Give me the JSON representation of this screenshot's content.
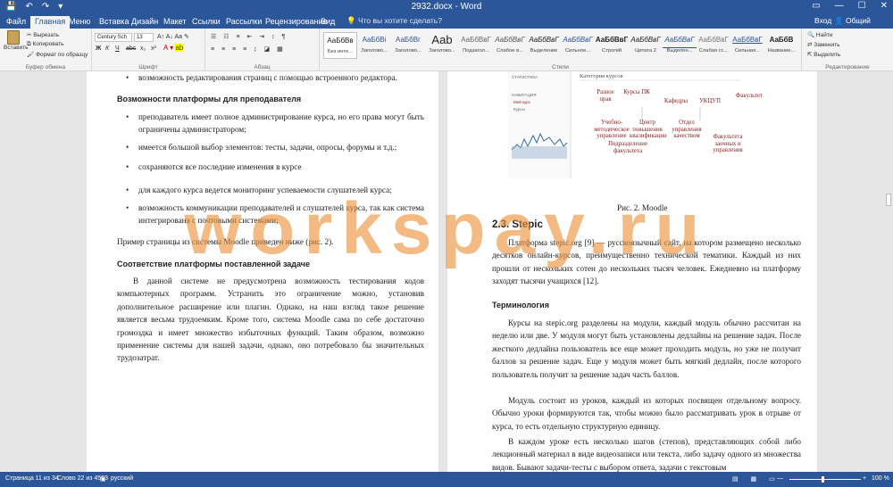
{
  "title_bar": {
    "doc_title": "2932.docx - Word",
    "quick_access": [
      "💾",
      "↶",
      "↷",
      "▾"
    ],
    "window_buttons": [
      "▭",
      "—",
      "☐",
      "✕"
    ]
  },
  "tabs": {
    "items": [
      "Файл",
      "Главная",
      "Меню",
      "Вставка",
      "Дизайн",
      "Макет",
      "Ссылки",
      "Рассылки",
      "Рецензирование",
      "Вид"
    ],
    "tell_me": "Что вы хотите сделать?",
    "sign_in": "Вход",
    "share": "Общий доступ"
  },
  "ribbon": {
    "clipboard": {
      "paste": "Вставить",
      "cut": "Вырезать",
      "copy": "Копировать",
      "format_painter": "Формат по образцу",
      "label": "Буфер обмена"
    },
    "font": {
      "family": "Century Sch",
      "size": "13",
      "label": "Шрифт",
      "bold": "Ж",
      "italic": "К",
      "underline": "Ч",
      "strike": "abc",
      "sub": "x₂",
      "sup": "x²"
    },
    "paragraph": {
      "label": "Абзац"
    },
    "styles": {
      "label": "Стили",
      "items": [
        {
          "sample": "АаБбВв",
          "name": "Без инте..."
        },
        {
          "sample": "АаБбВі",
          "name": "Заголово..."
        },
        {
          "sample": "АаБбВг",
          "name": "Заголово..."
        },
        {
          "sample": "Aab",
          "name": "Заголово..."
        },
        {
          "sample": "АаБбВвГ",
          "name": "Подзагол..."
        },
        {
          "sample": "АаБбВвГ",
          "name": "Слабое в..."
        },
        {
          "sample": "АаБбВвГ",
          "name": "Выделение"
        },
        {
          "sample": "АаБбВвГ",
          "name": "Сильное..."
        },
        {
          "sample": "АаБбВвГ",
          "name": "Строгий"
        },
        {
          "sample": "АаБбВвГ",
          "name": "Цитата 2"
        },
        {
          "sample": "АаБбВвГ",
          "name": "Выделен..."
        },
        {
          "sample": "АаБбВвГ",
          "name": "Слабая сс..."
        },
        {
          "sample": "АаБбВвГ",
          "name": "Сильная..."
        },
        {
          "sample": "АаБбВ",
          "name": "Название..."
        }
      ]
    },
    "editing": {
      "find": "Найти",
      "replace": "Заменить",
      "select": "Выделить",
      "label": "Редактирование"
    }
  },
  "page1": {
    "bullet_top": "возможность редактирования страниц с помощью встроенного редактора.",
    "heading1": "Возможности платформы для преподавателя",
    "bullets": [
      "преподаватель имеет полное администрирование курса, но его права могут быть ограничены администратором;",
      "имеется большой выбор элементов: тесты, задачи, опросы, форумы и т.д.;",
      "сохраняются все последние изменения в курсе",
      "для каждого курса ведется мониторинг успеваемости слушателей курса;",
      "возможность коммуникации преподавателей и слушателей курса, так как система интегрирована с почтовыми системами;"
    ],
    "example_line": "Пример страницы из системы Moodle приведен ниже (рис. 2).",
    "heading2": "Соответствие платформы поставленной задаче",
    "paragraph": "В данной системе не предусмотрена возможность тестирования кодов компьютерных программ. Устранить это ограничение можно, установив дополнительное расширение или плагин. Однако, на наш взгляд такое решение является весьма трудоемким. Кроме того, система Moodle сама по себе достаточно громоздка и имеет множество избыточных функций. Таким образом, возможно применение системы для нашей задачи, однако, оно потребовало бы значительных трудозатрат."
  },
  "page2": {
    "figure": {
      "category_label": "Категория курсов",
      "nodes": [
        "Разное прав",
        "Курсы ПК",
        "Кафедры",
        "УКЦУП",
        "Факультет",
        "Учебно-методическое управление",
        "Центр повышения квалификации",
        "Отдел управления качеством",
        "Подразделение факультета",
        "Факультета заочных и управления"
      ],
      "left_small": [
        "СТАТИСТИКА",
        "НАВИГАЦИЯ",
        "Мой курс",
        "Курсы"
      ],
      "caption": "Рис. 2. Moodle"
    },
    "heading": "2.3.  Stepic",
    "p1": "Платформа stepic.org [9] — русскоязычный сайт, на котором размещено несколько десятков онлайн-курсов, преимущественно технической тематики. Каждый из них прошли от нескольких сотен до нескольких тысяч человек. Ежедневно на платформу заходят тысячи учащихся [12].",
    "subheading": "Терминология",
    "p2": "Курсы на stepic.org разделены на модули, каждый модуль обычно рассчитан на неделю или две. У модуля могут быть установлены дедлайны на решение задач. После жесткого дедлайна пользователь все еще может проходить модуль, но уже не получит баллов за решение задач. Еще у модуля может быть мягкий дедлайн, после которого пользователь получит за решение задач часть баллов.",
    "p3": "Модуль состоит из уроков, каждый из которых посвящен отдельному вопросу. Обычно уроки формируются так, чтобы можно было рассматривать урок в отрыве от курса, то есть отдельную структурную единицу.",
    "p4": "В каждом уроке есть несколько шагов (степов), представляющих собой либо лекционный материал в виде видеозаписи или текста, либо задачу одного из множества видов. Бывают задачи-тесты с выбором ответа, задачи с текстовым"
  },
  "status_bar": {
    "page": "Страница 11 из 34",
    "words": "Слово 22 из 4563",
    "language": "русский",
    "zoom": "100 %"
  },
  "watermark": "workspay.ru",
  "colors": {
    "word_blue": "#2b579a",
    "ribbon_bg": "#f3f3f3",
    "watermark": "#eb9237",
    "figure_red": "#8b1a1a"
  }
}
